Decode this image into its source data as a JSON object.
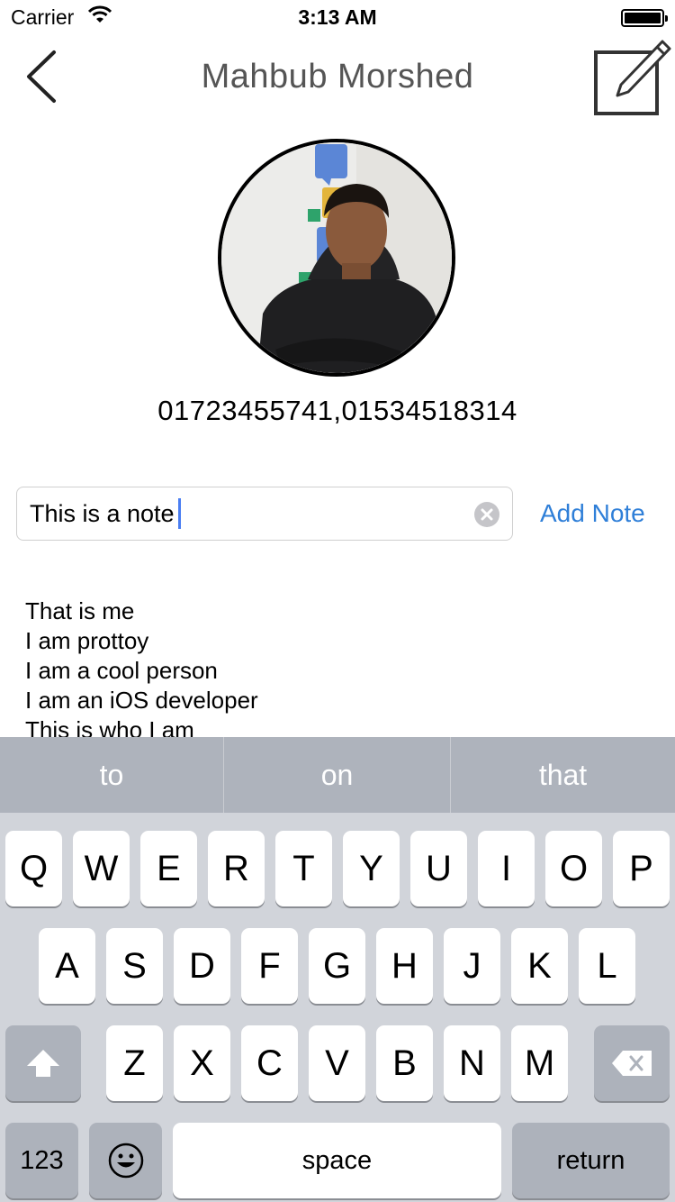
{
  "status_bar": {
    "carrier": "Carrier",
    "time": "3:13 AM"
  },
  "nav": {
    "title": "Mahbub  Morshed"
  },
  "contact": {
    "phones": "01723455741,01534518314"
  },
  "note_input": {
    "value": "This is a note",
    "add_label": "Add Note"
  },
  "notes": [
    "That is me",
    "I am prottoy",
    "I am a cool person",
    "I am an iOS developer",
    "This is who I am"
  ],
  "keyboard": {
    "suggestions": [
      "to",
      "on",
      "that"
    ],
    "row1": [
      "Q",
      "W",
      "E",
      "R",
      "T",
      "Y",
      "U",
      "I",
      "O",
      "P"
    ],
    "row2": [
      "A",
      "S",
      "D",
      "F",
      "G",
      "H",
      "J",
      "K",
      "L"
    ],
    "row3": [
      "Z",
      "X",
      "C",
      "V",
      "B",
      "N",
      "M"
    ],
    "numbers_label": "123",
    "space_label": "space",
    "return_label": "return"
  },
  "icons": {
    "back": "chevron-left-icon",
    "edit": "compose-icon",
    "clear": "clear-circle-icon",
    "shift": "shift-arrow-icon",
    "delete": "backspace-icon",
    "emoji": "emoji-icon"
  }
}
